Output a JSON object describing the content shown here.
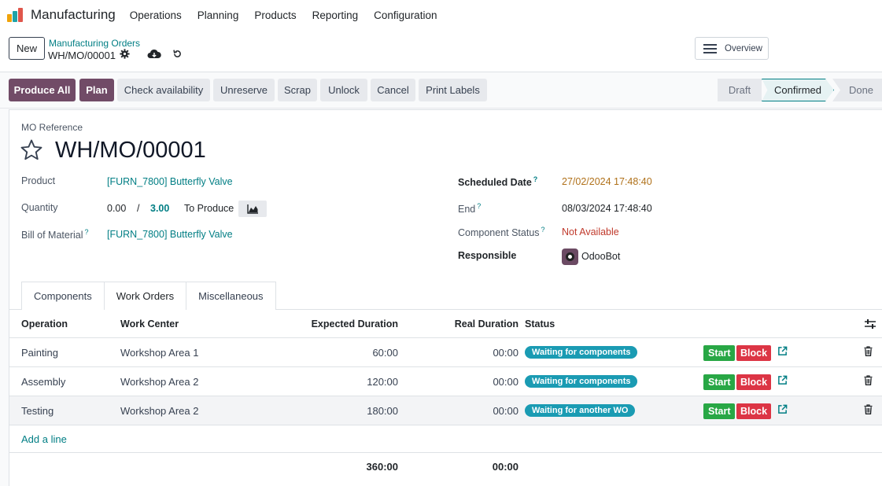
{
  "nav": {
    "app_name": "Manufacturing",
    "menu": [
      "Operations",
      "Planning",
      "Products",
      "Reporting",
      "Configuration"
    ]
  },
  "control": {
    "new_label": "New",
    "breadcrumb_parent": "Manufacturing Orders",
    "breadcrumb_current": "WH/MO/00001",
    "overview_label": "Overview"
  },
  "actions": {
    "produce_all": "Produce All",
    "plan": "Plan",
    "check_availability": "Check availability",
    "unreserve": "Unreserve",
    "scrap": "Scrap",
    "unlock": "Unlock",
    "cancel": "Cancel",
    "print_labels": "Print Labels"
  },
  "stages": {
    "draft": "Draft",
    "confirmed": "Confirmed",
    "done": "Done",
    "current": "Confirmed"
  },
  "form": {
    "mo_reference_label": "MO Reference",
    "mo_reference": "WH/MO/00001",
    "product_label": "Product",
    "product_value": "[FURN_7800] Butterfly Valve",
    "quantity_label": "Quantity",
    "quantity_produced": "0.00",
    "quantity_sep": "/",
    "quantity_total": "3.00",
    "quantity_suffix": "To Produce",
    "bom_label": "Bill of Material",
    "bom_value": "[FURN_7800] Butterfly Valve",
    "scheduled_label": "Scheduled Date",
    "scheduled_value": "27/02/2024 17:48:40",
    "end_label": "End",
    "end_value": "08/03/2024 17:48:40",
    "component_status_label": "Component Status",
    "component_status_value": "Not Available",
    "responsible_label": "Responsible",
    "responsible_value": "OdooBot",
    "help_mark": "?"
  },
  "tabs": [
    "Components",
    "Work Orders",
    "Miscellaneous"
  ],
  "table": {
    "headers": {
      "operation": "Operation",
      "work_center": "Work Center",
      "expected": "Expected Duration",
      "real": "Real Duration",
      "status": "Status"
    },
    "rows": [
      {
        "operation": "Painting",
        "work_center": "Workshop Area 1",
        "expected": "60:00",
        "real": "00:00",
        "status": "Waiting for components"
      },
      {
        "operation": "Assembly",
        "work_center": "Workshop Area 2",
        "expected": "120:00",
        "real": "00:00",
        "status": "Waiting for components"
      },
      {
        "operation": "Testing",
        "work_center": "Workshop Area 2",
        "expected": "180:00",
        "real": "00:00",
        "status": "Waiting for another WO"
      }
    ],
    "start_label": "Start",
    "block_label": "Block",
    "add_line": "Add a line",
    "total_expected": "360:00",
    "total_real": "00:00"
  },
  "colors": {
    "primary": "#714b67",
    "link": "#017e84",
    "badge": "#1a9bb3",
    "start": "#28a745",
    "block": "#dc3545"
  }
}
